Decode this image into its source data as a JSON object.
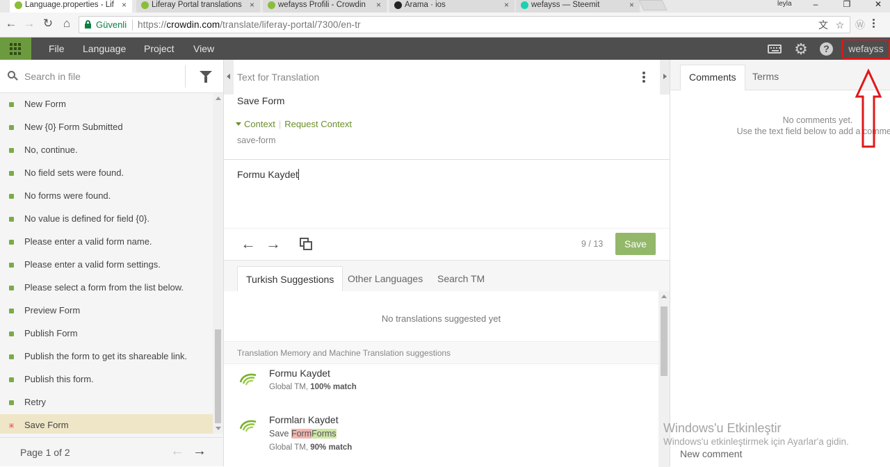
{
  "browser": {
    "tabs": [
      {
        "title": "Language.properties - Lif",
        "active": true,
        "favicon_color": "#8bbd3a"
      },
      {
        "title": "Liferay Portal translations",
        "active": false,
        "favicon_color": "#8bbd3a"
      },
      {
        "title": "wefayss Profili - Crowdin",
        "active": false,
        "favicon_color": "#8bbd3a"
      },
      {
        "title": "Arama · ios",
        "active": false,
        "favicon_color": "#222222"
      },
      {
        "title": "wefayss — Steemit",
        "active": false,
        "favicon_color": "#1bd1b1"
      }
    ],
    "tab_close_glyph": "×",
    "os_user": "leyla",
    "window_controls": {
      "minimize": "–",
      "restore": "❐",
      "close": "✕"
    },
    "secure_label": "Güvenli",
    "url": {
      "scheme": "https://",
      "host": "crowdin.com",
      "path": "/translate/liferay-portal/7300/en-tr"
    }
  },
  "toolbar": {
    "menu": [
      "File",
      "Language",
      "Project",
      "View"
    ],
    "user": "wefayss",
    "accent_color": "#6c9a3f"
  },
  "left": {
    "search_placeholder": "Search in file",
    "strings": [
      {
        "text": "New Form",
        "status": "translated"
      },
      {
        "text": "New {0} Form Submitted",
        "status": "translated"
      },
      {
        "text": "No, continue.",
        "status": "translated"
      },
      {
        "text": "No field sets were found.",
        "status": "translated"
      },
      {
        "text": "No forms were found.",
        "status": "translated"
      },
      {
        "text": "No value is defined for field {0}.",
        "status": "translated"
      },
      {
        "text": "Please enter a valid form name.",
        "status": "translated"
      },
      {
        "text": "Please enter a valid form settings.",
        "status": "translated"
      },
      {
        "text": "Please select a form from the list below.",
        "status": "translated"
      },
      {
        "text": "Preview Form",
        "status": "translated"
      },
      {
        "text": "Publish Form",
        "status": "translated"
      },
      {
        "text": "Publish the form to get its shareable link.",
        "status": "translated"
      },
      {
        "text": "Publish this form.",
        "status": "translated"
      },
      {
        "text": "Retry",
        "status": "translated"
      },
      {
        "text": "Save Form",
        "status": "untranslated",
        "selected": true
      }
    ],
    "pager": "Page 1 of 2"
  },
  "editor": {
    "heading": "Text for Translation",
    "source_text": "Save Form",
    "context_label": "Context",
    "request_context_label": "Request Context",
    "context_key": "save-form",
    "translation": "Formu Kaydet",
    "counter": "9 / 13",
    "save_label": "Save",
    "save_color": "#93b86a",
    "suggestion_tabs": [
      "Turkish Suggestions",
      "Other Languages",
      "Search TM"
    ],
    "no_suggestions": "No translations suggested yet",
    "tm_header": "Translation Memory and Machine Translation suggestions",
    "tm_results": [
      {
        "text": "Formu Kaydet",
        "source": "Global TM,",
        "match": "100% match"
      },
      {
        "text": "Formları Kaydet",
        "diff": {
          "base": "Save ",
          "removed": "Form",
          "added": "Forms"
        },
        "source": "Global TM,",
        "match": "90% match"
      }
    ]
  },
  "right": {
    "tabs": [
      "Comments",
      "Terms"
    ],
    "no_comments_line1": "No comments yet.",
    "no_comments_line2": "Use the text field below to add a comment",
    "new_comment_placeholder": "New comment"
  },
  "os_overlay": {
    "title": "Windows'u Etkinleştir",
    "subtitle": "Windows'u etkinleştirmek için Ayarlar'a gidin."
  }
}
